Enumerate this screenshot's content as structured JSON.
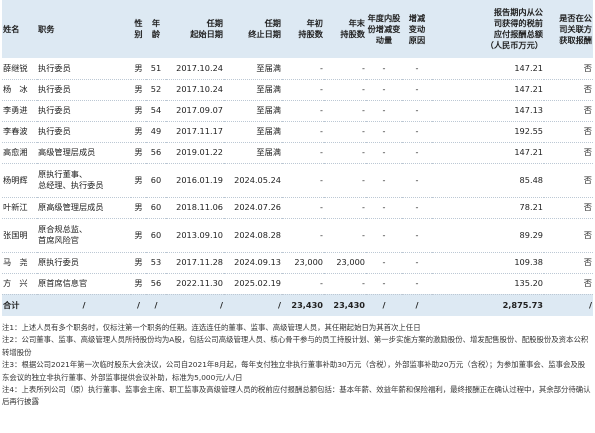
{
  "headers": {
    "name": "姓名",
    "position": "职务",
    "gender": [
      "性",
      "别"
    ],
    "age": [
      "年",
      "龄"
    ],
    "start": [
      "任期",
      "起始日期"
    ],
    "end": [
      "任期",
      "终止日期"
    ],
    "shares_begin": [
      "年初",
      "持股数"
    ],
    "shares_end": [
      "年末",
      "持股数"
    ],
    "change": [
      "年度内股",
      "份增减变",
      "动量"
    ],
    "reason": [
      "增减",
      "变动",
      "原因"
    ],
    "pay": [
      "报告期内从公",
      "司获得的税前",
      "应付报酬总额",
      "（人民币万元）"
    ],
    "related": [
      "是否在公",
      "司关联方",
      "获取报酬"
    ]
  },
  "rows": [
    {
      "name": "薛继锐",
      "position": [
        "执行委员"
      ],
      "gender": "男",
      "age": "51",
      "start": "2017.10.24",
      "end": "至届满",
      "shares_begin": "-",
      "shares_end": "-",
      "change": "-",
      "reason": "-",
      "pay": "147.21",
      "related": "否"
    },
    {
      "name": "杨　冰",
      "position": [
        "执行委员"
      ],
      "gender": "男",
      "age": "52",
      "start": "2017.10.24",
      "end": "至届满",
      "shares_begin": "-",
      "shares_end": "-",
      "change": "-",
      "reason": "-",
      "pay": "147.21",
      "related": "否"
    },
    {
      "name": "李勇进",
      "position": [
        "执行委员"
      ],
      "gender": "男",
      "age": "54",
      "start": "2017.09.07",
      "end": "至届满",
      "shares_begin": "-",
      "shares_end": "-",
      "change": "-",
      "reason": "-",
      "pay": "147.13",
      "related": "否"
    },
    {
      "name": "李春波",
      "position": [
        "执行委员"
      ],
      "gender": "男",
      "age": "49",
      "start": "2017.11.17",
      "end": "至届满",
      "shares_begin": "-",
      "shares_end": "-",
      "change": "-",
      "reason": "-",
      "pay": "192.55",
      "related": "否"
    },
    {
      "name": "高愈湘",
      "position": [
        "高级管理层成员"
      ],
      "gender": "男",
      "age": "56",
      "start": "2019.01.22",
      "end": "至届满",
      "shares_begin": "-",
      "shares_end": "-",
      "change": "-",
      "reason": "-",
      "pay": "147.21",
      "related": "否"
    },
    {
      "name": "杨明辉",
      "position": [
        "原执行董事、",
        "总经理、执行委员"
      ],
      "gender": "男",
      "age": "60",
      "start": "2016.01.19",
      "end": "2024.05.24",
      "shares_begin": "-",
      "shares_end": "-",
      "change": "-",
      "reason": "-",
      "pay": "85.48",
      "related": "否"
    },
    {
      "name": "叶新江",
      "position": [
        "原高级管理层成员"
      ],
      "gender": "男",
      "age": "60",
      "start": "2018.11.06",
      "end": "2024.07.26",
      "shares_begin": "-",
      "shares_end": "-",
      "change": "-",
      "reason": "-",
      "pay": "78.21",
      "related": "否"
    },
    {
      "name": "张国明",
      "position": [
        "原合规总监、",
        "首席风险官"
      ],
      "gender": "男",
      "age": "60",
      "start": "2013.09.10",
      "end": "2024.08.28",
      "shares_begin": "-",
      "shares_end": "-",
      "change": "-",
      "reason": "-",
      "pay": "89.29",
      "related": "否"
    },
    {
      "name": "马　尧",
      "position": [
        "原执行委员"
      ],
      "gender": "男",
      "age": "53",
      "start": "2017.11.28",
      "end": "2024.09.13",
      "shares_begin": "23,000",
      "shares_end": "23,000",
      "change": "-",
      "reason": "-",
      "pay": "109.38",
      "related": "否"
    },
    {
      "name": "方　兴",
      "position": [
        "原首席信息官"
      ],
      "gender": "男",
      "age": "56",
      "start": "2022.11.30",
      "end": "2025.02.19",
      "shares_begin": "-",
      "shares_end": "-",
      "change": "-",
      "reason": "-",
      "pay": "135.20",
      "related": "否"
    }
  ],
  "total": {
    "name": "合计",
    "position": "/",
    "gender": "/",
    "age": "/",
    "start": "/",
    "end": "/",
    "shares_begin": "23,430",
    "shares_end": "23,430",
    "change": "/",
    "reason": "/",
    "pay": "2,875.73",
    "related": "/"
  },
  "notes": [
    "注1：上述人员有多个职务时，仅标注第一个职务的任期。连选连任的董事、监事、高级管理人员，其任期起始日为其首次上任日",
    "注2：公司董事、监事、高级管理人员所持股份均为A股，包括公司高级管理人员、核心骨干参与的员工持股计划、第一步实施方案的激励股份、增发配售股份、配股股份及资本公积转增股份",
    "注3：根据公司2021年第一次临时股东大会决议，公司自2021年8月起，每年支付独立非执行董事补助30万元（含税），外部监事补助20万元（含税）；为参加董事会、监事会及股东会议的独立非执行董事、外部监事提供会议补助，标准为5,000元/人/日",
    "注4：上表所列公司（原）执行董事、监事会主席、职工监事及高级管理人员的税前应付报酬总额包括：基本年薪、效益年薪和保险福利，最终报酬正在确认过程中，其余部分待确认后再行披露"
  ]
}
